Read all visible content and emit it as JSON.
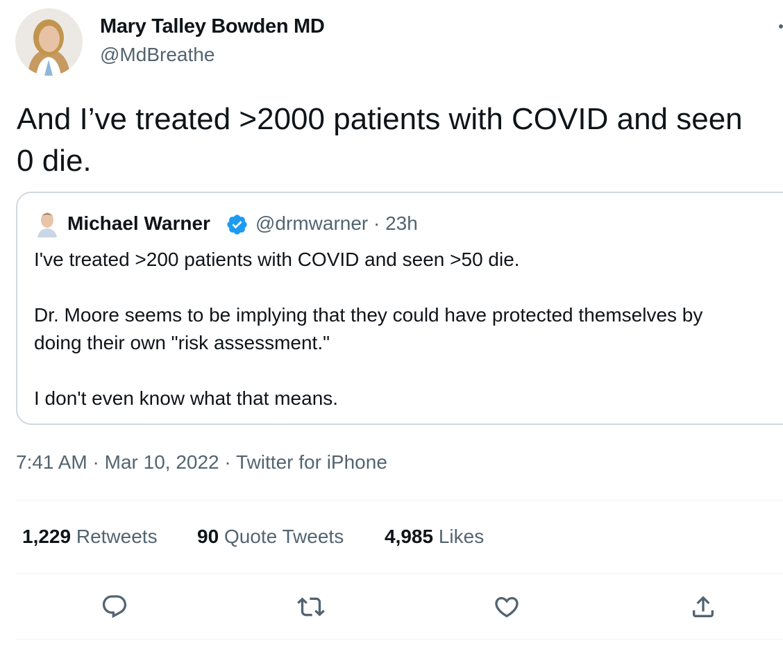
{
  "author": {
    "name": "Mary Talley Bowden MD",
    "handle": "@MdBreathe"
  },
  "tweet": {
    "lines": [
      "And I’ve treated >2000 patients with COVID and seen",
      "0 die."
    ]
  },
  "quote": {
    "name": "Michael Warner",
    "handle_time": "@drmwarner · 23h",
    "paragraphs": [
      "I've treated >200 patients with COVID and seen >50 die.",
      "Dr. Moore seems to be implying that they could have protected themselves by",
      "doing their own \"risk assessment.\"",
      "I don't even know what that means."
    ]
  },
  "meta": {
    "time": "7:41 AM",
    "date": "Mar 10, 2022",
    "source": "Twitter for iPhone",
    "separator": " · "
  },
  "stats": {
    "retweets_count": "1,229",
    "retweets_label": "Retweets",
    "quotes_count": "90",
    "quotes_label": "Quote Tweets",
    "likes_count": "4,985",
    "likes_label": "Likes"
  },
  "icons": {
    "reply": "reply-icon",
    "retweet": "retweet-icon",
    "like": "heart-icon",
    "share": "share-icon",
    "more": "more-icon",
    "verified": "verified-badge-icon"
  },
  "colors": {
    "text": "#0f1419",
    "secondary": "#536471",
    "border": "#cfd9de",
    "verified": "#1d9bf0"
  }
}
